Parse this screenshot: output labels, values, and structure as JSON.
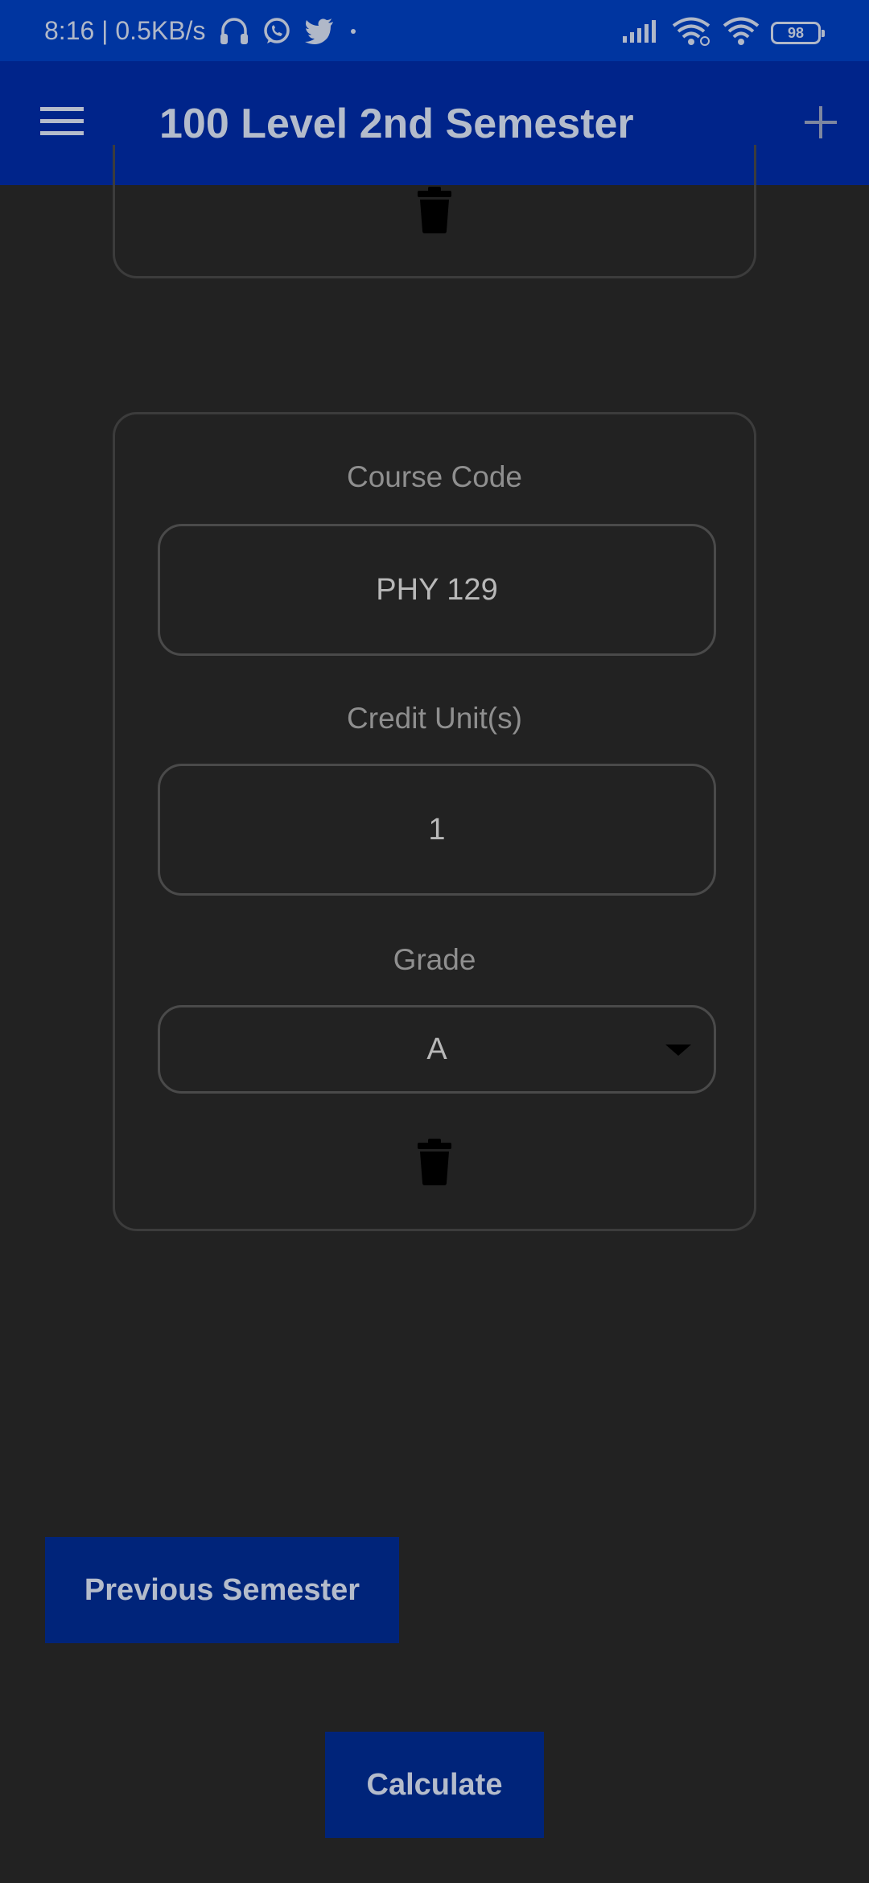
{
  "status_bar": {
    "time": "8:16",
    "separator": "|",
    "network_speed": "0.5KB/s",
    "left_icons": [
      "headphones-icon",
      "whatsapp-icon",
      "twitter-icon",
      "dot-icon"
    ],
    "right_icons": [
      "signal-icon",
      "wifi-icon",
      "wifi-icon"
    ],
    "battery_level": "98"
  },
  "app_bar": {
    "title": "100 Level 2nd Semester",
    "menu_icon": "hamburger-menu-icon",
    "add_icon": "plus-icon"
  },
  "course_card": {
    "course_code_label": "Course Code",
    "course_code_value": "PHY 129",
    "credit_units_label": "Credit Unit(s)",
    "credit_units_value": "1",
    "grade_label": "Grade",
    "grade_value": "A",
    "delete_icon": "trash-icon"
  },
  "buttons": {
    "previous_semester": "Previous Semester",
    "calculate": "Calculate"
  },
  "colors": {
    "status_bar": "#0035a0",
    "app_bar": "#00248a",
    "background": "#222222",
    "button": "#00247a",
    "text_light": "#b4bccb"
  }
}
